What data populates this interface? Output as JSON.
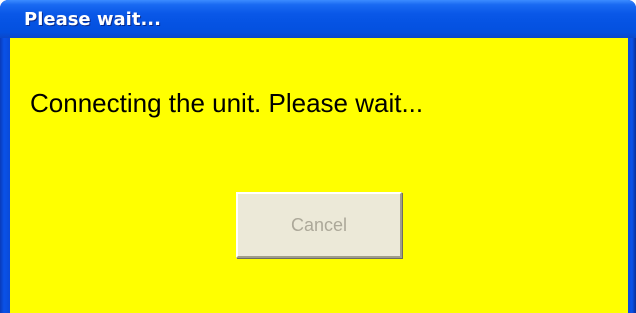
{
  "window": {
    "title": "Please wait..."
  },
  "dialog": {
    "message": "Connecting the unit. Please wait...",
    "cancel_label": "Cancel",
    "cancel_enabled": false
  },
  "colors": {
    "title_bar": "#0553e3",
    "client_background": "#ffff00",
    "button_face": "#ece9d8",
    "disabled_text": "#aca899"
  }
}
